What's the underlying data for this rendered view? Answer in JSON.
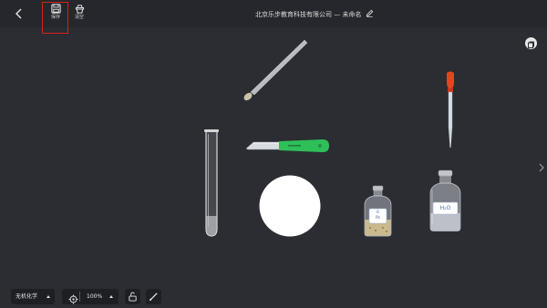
{
  "toolbar": {
    "save_label": "保存",
    "clear_label": "清空"
  },
  "document": {
    "title": "北京乐步教育科技有限公司 — 未命名"
  },
  "bottom": {
    "font_select": "无机化学",
    "zoom": "100%"
  },
  "canvas": {
    "bottle_small_label_top": "B",
    "bottle_small_label_bottom": "Pb",
    "bottle_large_label": "H₂O"
  },
  "colors": {
    "background": "#2b2d33",
    "topbar": "#25272c",
    "highlight": "#d62020",
    "knife_handle": "#2fbf59",
    "dropper_bulb": "#e1461f"
  },
  "icons": {
    "back": "chevron-left-icon",
    "save": "floppy-disk-icon",
    "clear": "basket-icon",
    "edit": "pencil-icon",
    "copy": "copy-icon",
    "target": "crosshair-icon",
    "lock": "unlock-icon",
    "pen": "pen-icon"
  }
}
